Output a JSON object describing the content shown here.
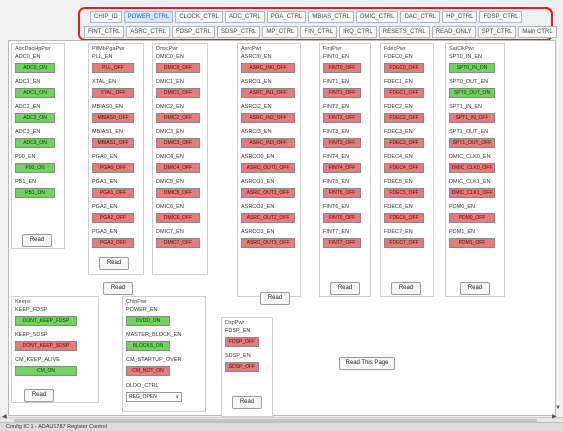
{
  "tabs_row1": [
    "CHIP_ID",
    "POWER_CTRL",
    "CLOCK_CTRL",
    "ADC_CTRL",
    "PGA_CTRL",
    "MBIAS_CTRL",
    "DMIC_CTRL",
    "DAC_CTRL",
    "HP_CTRL",
    "FDSP_CTRL"
  ],
  "tabs_row2": [
    "FINT_CTRL",
    "ASRC_CTRL",
    "FDSP_CTRL",
    "SDSP_CTRL",
    "MP_CTRL",
    "FIN_CTRL",
    "IRQ_CTRL",
    "RESETS_CTRL",
    "READ_ONLY",
    "SPT_CTRL",
    "Main CTRL"
  ],
  "active_tab": "POWER_CTRL",
  "read_label": "Read",
  "g1": {
    "title": "AdcDacHpPwr",
    "items": [
      {
        "label": "ADC0_EN",
        "btn": "ADC0_ON",
        "on": true
      },
      {
        "label": "ADC1_EN",
        "btn": "ADC1_ON",
        "on": true
      },
      {
        "label": "ADC2_EN",
        "btn": "ADC2_ON",
        "on": true
      },
      {
        "label": "ADC3_EN",
        "btn": "ADC3_ON",
        "on": true
      },
      {
        "label": "P00_EN",
        "btn": "P00_ON",
        "on": true
      },
      {
        "label": "PB1_EN",
        "btn": "PB1_ON",
        "on": true
      }
    ]
  },
  "g2": {
    "title": "PllMbPgaPwr",
    "items": [
      {
        "label": "PLL_EN",
        "btn": "PLL_OFF",
        "on": false
      },
      {
        "label": "XTAL_EN",
        "btn": "XTAL_OFF",
        "on": false
      },
      {
        "label": "MBIAS0_EN",
        "btn": "MBIAS0_OFF",
        "on": false
      },
      {
        "label": "MBIAS1_EN",
        "btn": "MBIAS1_OFF",
        "on": false
      },
      {
        "label": "PGA0_EN",
        "btn": "PGA0_OFF",
        "on": false
      },
      {
        "label": "PGA1_EN",
        "btn": "PGA1_OFF",
        "on": false
      },
      {
        "label": "PGA2_EN",
        "btn": "PGA2_OFF",
        "on": false
      },
      {
        "label": "PGA3_EN",
        "btn": "PGA3_OFF",
        "on": false
      }
    ]
  },
  "g3": {
    "title": "DmicPwr",
    "items": [
      {
        "label": "DMIC0_EN",
        "btn": "DMIC0_OFF",
        "on": false
      },
      {
        "label": "DMIC1_EN",
        "btn": "DMIC1_OFF",
        "on": false
      },
      {
        "label": "DMIC2_EN",
        "btn": "DMIC2_OFF",
        "on": false
      },
      {
        "label": "DMIC3_EN",
        "btn": "DMIC3_OFF",
        "on": false
      },
      {
        "label": "DMIC4_EN",
        "btn": "DMIC4_OFF",
        "on": false
      },
      {
        "label": "DMIC5_EN",
        "btn": "DMIC5_OFF",
        "on": false
      },
      {
        "label": "DMIC6_EN",
        "btn": "DMIC6_OFF",
        "on": false
      },
      {
        "label": "DMIC7_EN",
        "btn": "DMIC7_OFF",
        "on": false
      }
    ]
  },
  "g4": {
    "title": "AsrcPwr",
    "items": [
      {
        "label": "ASRCI0_EN",
        "btn": "ASRC_IN0_OFF",
        "on": false
      },
      {
        "label": "ASRCI1_EN",
        "btn": "ASRC_IN1_OFF",
        "on": false
      },
      {
        "label": "ASRCI2_EN",
        "btn": "ASRC_IN2_OFF",
        "on": false
      },
      {
        "label": "ASRCI3_EN",
        "btn": "ASRC_IN3_OFF",
        "on": false
      },
      {
        "label": "ASRCO0_EN",
        "btn": "ASRC_OUT0_OFF",
        "on": false
      },
      {
        "label": "ASRCO1_EN",
        "btn": "ASRC_OUT1_OFF",
        "on": false
      },
      {
        "label": "ASRCO2_EN",
        "btn": "ASRC_OUT2_OFF",
        "on": false
      },
      {
        "label": "ASRCO3_EN",
        "btn": "ASRC_OUT3_OFF",
        "on": false
      }
    ]
  },
  "g5": {
    "title": "FintPwr",
    "items": [
      {
        "label": "FINT0_EN",
        "btn": "FINT0_OFF",
        "on": false
      },
      {
        "label": "FINT1_EN",
        "btn": "FINT1_OFF",
        "on": false
      },
      {
        "label": "FINT2_EN",
        "btn": "FINT2_OFF",
        "on": false
      },
      {
        "label": "FINT3_EN",
        "btn": "FINT3_OFF",
        "on": false
      },
      {
        "label": "FINT4_EN",
        "btn": "FINT4_OFF",
        "on": false
      },
      {
        "label": "FINT5_EN",
        "btn": "FINT5_OFF",
        "on": false
      },
      {
        "label": "FINT6_EN",
        "btn": "FINT6_OFF",
        "on": false
      },
      {
        "label": "FINT7_EN",
        "btn": "FINT7_OFF",
        "on": false
      }
    ]
  },
  "g6": {
    "title": "FdecPwr",
    "items": [
      {
        "label": "FDEC0_EN",
        "btn": "FDEC0_OFF",
        "on": false
      },
      {
        "label": "FDEC1_EN",
        "btn": "FDEC1_OFF",
        "on": false
      },
      {
        "label": "FDEC2_EN",
        "btn": "FDEC2_OFF",
        "on": false
      },
      {
        "label": "FDEC3_EN",
        "btn": "FDEC3_OFF",
        "on": false
      },
      {
        "label": "FDEC4_EN",
        "btn": "FDEC4_OFF",
        "on": false
      },
      {
        "label": "FDEC5_EN",
        "btn": "FDEC5_OFF",
        "on": false
      },
      {
        "label": "FDEC6_EN",
        "btn": "FDEC6_OFF",
        "on": false
      },
      {
        "label": "FDEC7_EN",
        "btn": "FDEC7_OFF",
        "on": false
      }
    ]
  },
  "g7": {
    "title": "SaiClkPwr",
    "items": [
      {
        "label": "SPT0_IN_EN",
        "btn": "SPT0_IN_ON",
        "on": true
      },
      {
        "label": "SPT0_OUT_EN",
        "btn": "SPT0_OUT_ON",
        "on": true
      },
      {
        "label": "SPT1_IN_EN",
        "btn": "SPT1_IN_OFF",
        "on": false
      },
      {
        "label": "SPT1_OUT_EN",
        "btn": "SPT1_OUT_OFF",
        "on": false
      },
      {
        "label": "DMIC_CLK0_EN",
        "btn": "DMIC_CLK0_OFF",
        "on": false
      },
      {
        "label": "DMIC_CLK1_EN",
        "btn": "DMIC_CLK1_OFF",
        "on": false
      },
      {
        "label": "PDM0_EN",
        "btn": "PDM0_OFF",
        "on": false
      },
      {
        "label": "PDM1_EN",
        "btn": "PDM1_OFF",
        "on": false
      }
    ]
  },
  "g8": {
    "title": "Keeps",
    "items": [
      {
        "label": "KEEP_FDSP",
        "btn": "DONT_KEEP_FDSP",
        "on": true
      },
      {
        "label": "KEEP_SDSP",
        "btn": "DONT_KEEP_SDSP",
        "on": false
      },
      {
        "label": "CM_KEEP_ALIVE",
        "btn": "CM_ON",
        "on": true
      }
    ]
  },
  "g9": {
    "title": "ChipPwr",
    "items": [
      {
        "label": "POWER_EN",
        "btn": "DVDD_ON",
        "on": true
      },
      {
        "label": "MASTER_BLOCK_EN",
        "btn": "BLOCKS_ON",
        "on": true
      },
      {
        "label": "CM_STARTUP_OVER",
        "btn": "CM_NOT_ON",
        "on": false
      }
    ],
    "combo_label": "DLDO_CTRL",
    "combo_value": "REG_OPEN"
  },
  "g10": {
    "title": "DspPwr",
    "items": [
      {
        "label": "FDSP_EN",
        "btn": "FDSP_OFF",
        "on": false
      },
      {
        "label": "SDSP_EN",
        "btn": "SDSP_OFF",
        "on": false
      }
    ]
  },
  "read_page": "Read This Page",
  "status_text": "Config  IC 1 - ADAU1787 Register Control",
  "colors": {
    "on": "#6fd35e",
    "off": "#e77a7a",
    "tab_outline": "#e02020",
    "active_tab_text": "#1b56c8"
  },
  "icons": [
    "scroll-left-arrow-icon",
    "scroll-right-arrow-icon",
    "scroll-down-arrow-icon",
    "dropdown-arrow-icon"
  ]
}
